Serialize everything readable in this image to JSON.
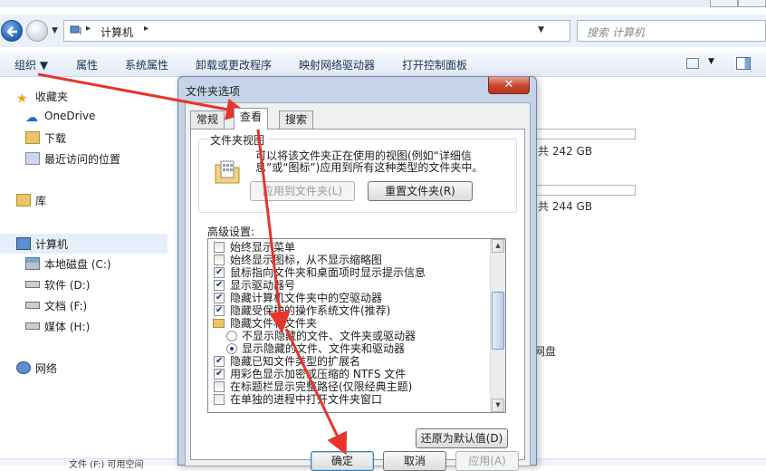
{
  "explorer": {
    "address_path": "计算机",
    "search_placeholder": "搜索 计算机",
    "commands": [
      "组织",
      "属性",
      "系统属性",
      "卸载或更改程序",
      "映射网络驱动器",
      "打开控制面板"
    ],
    "nav": {
      "favorites": "收藏夹",
      "onedrive": "OneDrive",
      "downloads": "下载",
      "recent": "最近访问的位置",
      "library": "库",
      "computer": "计算机",
      "drive_c": "本地磁盘 (C:)",
      "drive_d": "软件 (D:)",
      "drive_f": "文档 (F:)",
      "drive_h": "媒体 (H:)",
      "network": "网络"
    },
    "content": {
      "drive1_free": "共 242 GB",
      "drive2_free": "共 244 GB",
      "other_fragment": "网盘"
    },
    "status_fragment": "文件 (F:) 可用空间"
  },
  "dialog": {
    "title": "文件夹选项",
    "close_glyph": "✕",
    "tabs": [
      "常规",
      "查看",
      "搜索"
    ],
    "active_tab": "查看",
    "folder_view": {
      "legend": "文件夹视图",
      "description": "可以将该文件夹正在使用的视图(例如“详细信息”或“图标”)应用到所有这种类型的文件夹中。",
      "apply_button": "应用到文件夹(L)",
      "reset_button": "重置文件夹(R)"
    },
    "advanced_label": "高级设置:",
    "advanced_items": [
      {
        "type": "checkbox",
        "checked": false,
        "label": "始终显示菜单"
      },
      {
        "type": "checkbox",
        "checked": false,
        "label": "始终显示图标，从不显示缩略图"
      },
      {
        "type": "checkbox",
        "checked": true,
        "label": "鼠标指向文件夹和桌面项时显示提示信息"
      },
      {
        "type": "checkbox",
        "checked": true,
        "label": "显示驱动器号"
      },
      {
        "type": "checkbox",
        "checked": true,
        "label": "隐藏计算机文件夹中的空驱动器"
      },
      {
        "type": "checkbox",
        "checked": true,
        "label": "隐藏受保护的操作系统文件(推荐)"
      },
      {
        "type": "folder",
        "label": "隐藏文件和文件夹"
      },
      {
        "type": "radio",
        "checked": false,
        "label": "不显示隐藏的文件、文件夹或驱动器"
      },
      {
        "type": "radio",
        "checked": true,
        "label": "显示隐藏的文件、文件夹和驱动器"
      },
      {
        "type": "checkbox",
        "checked": true,
        "label": "隐藏已知文件类型的扩展名"
      },
      {
        "type": "checkbox",
        "checked": true,
        "label": "用彩色显示加密或压缩的 NTFS 文件"
      },
      {
        "type": "checkbox",
        "checked": false,
        "label": "在标题栏显示完整路径(仅限经典主题)"
      },
      {
        "type": "checkbox",
        "checked": false,
        "label": "在单独的进程中打开文件夹窗口"
      }
    ],
    "restore_defaults": "还原为默认值(D)",
    "ok": "确定",
    "cancel": "取消",
    "apply": "应用(A)"
  },
  "annotation_color": "#e8342a"
}
